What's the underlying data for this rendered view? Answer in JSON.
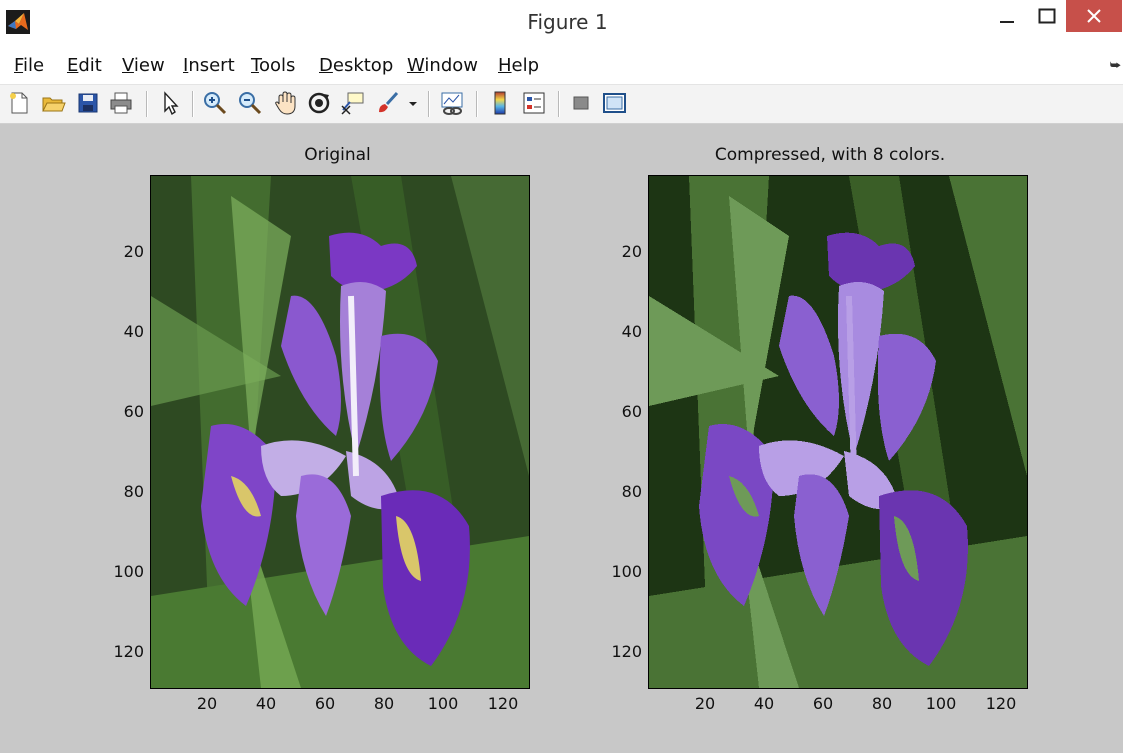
{
  "window": {
    "title": "Figure 1"
  },
  "menu": {
    "file": {
      "key": "F",
      "rest": "ile"
    },
    "edit": {
      "key": "E",
      "rest": "dit"
    },
    "view": {
      "key": "V",
      "rest": "iew"
    },
    "insert": {
      "key": "I",
      "rest": "nsert"
    },
    "tools": {
      "key": "T",
      "rest": "ools"
    },
    "desktop": {
      "key": "D",
      "rest": "esktop"
    },
    "window": {
      "key": "W",
      "rest": "indow"
    },
    "help": {
      "key": "H",
      "rest": "elp"
    }
  },
  "toolbar_icons": [
    "new-figure-icon",
    "open-file-icon",
    "save-icon",
    "print-icon",
    "edit-plot-arrow-icon",
    "zoom-in-icon",
    "zoom-out-icon",
    "pan-hand-icon",
    "rotate-3d-icon",
    "data-cursor-icon",
    "brush-icon",
    "link-plot-icon",
    "colorbar-icon",
    "legend-icon",
    "hide-plot-tools-icon",
    "show-plot-tools-icon"
  ],
  "axes": [
    {
      "title": "Original",
      "yticks": [
        "20",
        "40",
        "60",
        "80",
        "100",
        "120"
      ],
      "xticks": [
        "20",
        "40",
        "60",
        "80",
        "100",
        "120"
      ]
    },
    {
      "title": "Compressed, with 8 colors.",
      "yticks": [
        "20",
        "40",
        "60",
        "80",
        "100",
        "120"
      ],
      "xticks": [
        "20",
        "40",
        "60",
        "80",
        "100",
        "120"
      ]
    }
  ],
  "colors": {
    "figure_bg": "#c8c8c8",
    "close_button": "#c7504a"
  }
}
